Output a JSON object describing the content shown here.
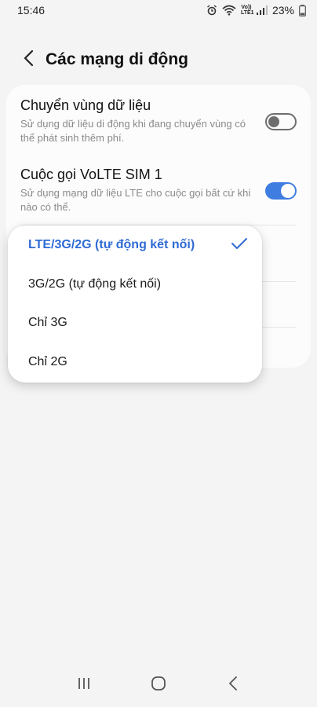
{
  "status_bar": {
    "time": "15:46",
    "volte_line1": "Vo))",
    "volte_line2": "LTE1",
    "battery": "23%",
    "icons": [
      "alarm-icon",
      "wifi-icon",
      "volte-icon",
      "signal-icon",
      "battery-icon"
    ]
  },
  "header": {
    "title": "Các mạng di động",
    "back_icon": "back-arrow-icon"
  },
  "settings": {
    "items": [
      {
        "title": "Chuyển vùng dữ liệu",
        "description": "Sử dụng dữ liệu di động khi đang chuyển vùng có thể phát sinh thêm phí.",
        "enabled": false
      },
      {
        "title": "Cuộc gọi VoLTE SIM 1",
        "description": "Sử dụng mạng dữ liệu LTE cho cuộc gọi bất cứ khi nào có thể.",
        "enabled": true
      }
    ]
  },
  "network_mode_dropdown": {
    "selected_index": 0,
    "options": [
      "LTE/3G/2G (tự động kết nối)",
      "3G/2G (tự động kết nối)",
      "Chỉ 3G",
      "Chỉ 2G"
    ],
    "check_icon": "checkmark-icon"
  },
  "nav_bar": {
    "icons": [
      "recent-apps-icon",
      "home-icon",
      "back-icon"
    ]
  },
  "colors": {
    "accent": "#3f7de0",
    "selected_text": "#2f6bd4",
    "background": "#f4f4f4",
    "card": "#fcfcfc"
  }
}
